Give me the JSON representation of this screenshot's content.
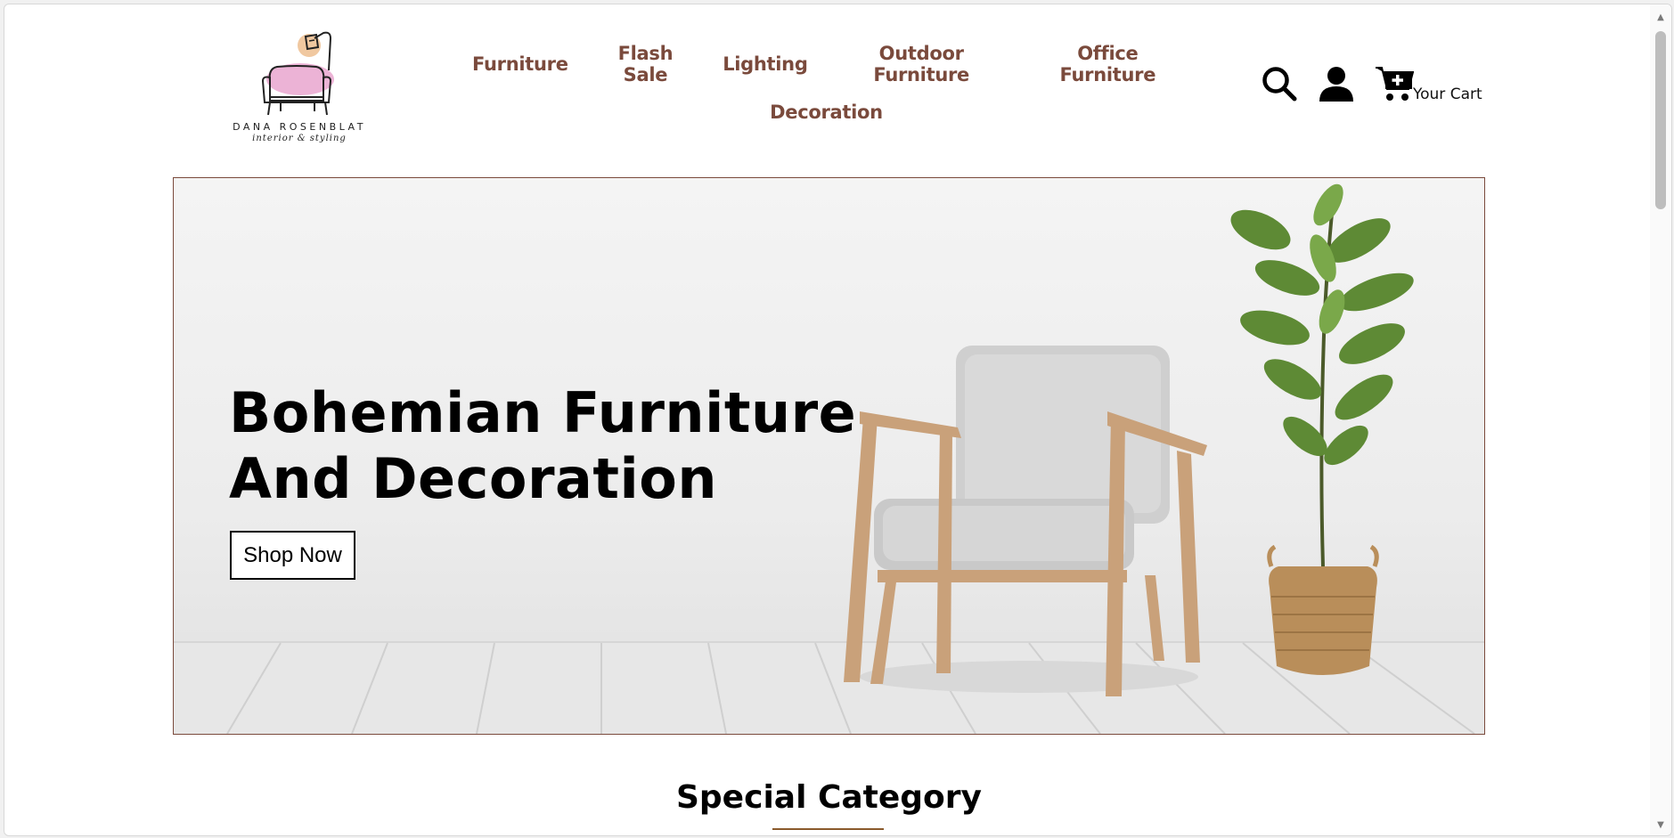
{
  "brand": {
    "name": "DANA ROSENBLAT",
    "tagline": "interior & styling"
  },
  "nav": {
    "row1": [
      "Furniture",
      "Flash Sale",
      "Lighting",
      "Outdoor Furniture",
      "Office Furniture"
    ],
    "row2": [
      "Decoration"
    ]
  },
  "header_icons": {
    "search": "search-icon",
    "account": "user-icon",
    "cart": "cart-plus-icon",
    "cart_label": "Your Cart"
  },
  "hero": {
    "title": "Bohemian Furniture And Decoration",
    "button_label": "Shop Now"
  },
  "sections": {
    "special_category_title": "Special Category"
  },
  "colors": {
    "accent": "#7a4a3c",
    "underline": "#8a5a2c",
    "logo_pink": "#e9a6cf",
    "logo_peach": "#f0c8a0"
  }
}
